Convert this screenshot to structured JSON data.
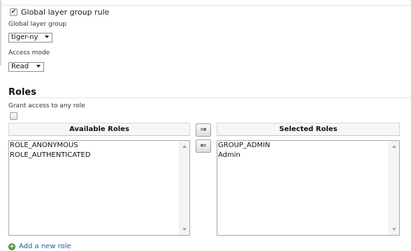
{
  "global_rule": {
    "checkbox_label": "Global layer group rule",
    "checked": true,
    "group_label": "Global layer group",
    "group_value": "tiger-ny",
    "access_label": "Access mode",
    "access_value": "Read"
  },
  "roles": {
    "heading": "Roles",
    "grant_label": "Grant access to any role",
    "grant_checked": false,
    "available_header": "Available Roles",
    "selected_header": "Selected Roles",
    "available": [
      "ROLE_ANONYMOUS",
      "ROLE_AUTHENTICATED"
    ],
    "selected": [
      "GROUP_ADMIN",
      "Admin"
    ],
    "add_button_glyph": "⇒",
    "remove_button_glyph": "⇐",
    "add_new_role": "Add a new role"
  },
  "icons": {
    "add_role_icon": "plus-circle-icon",
    "accent_color": "#58a33c"
  }
}
